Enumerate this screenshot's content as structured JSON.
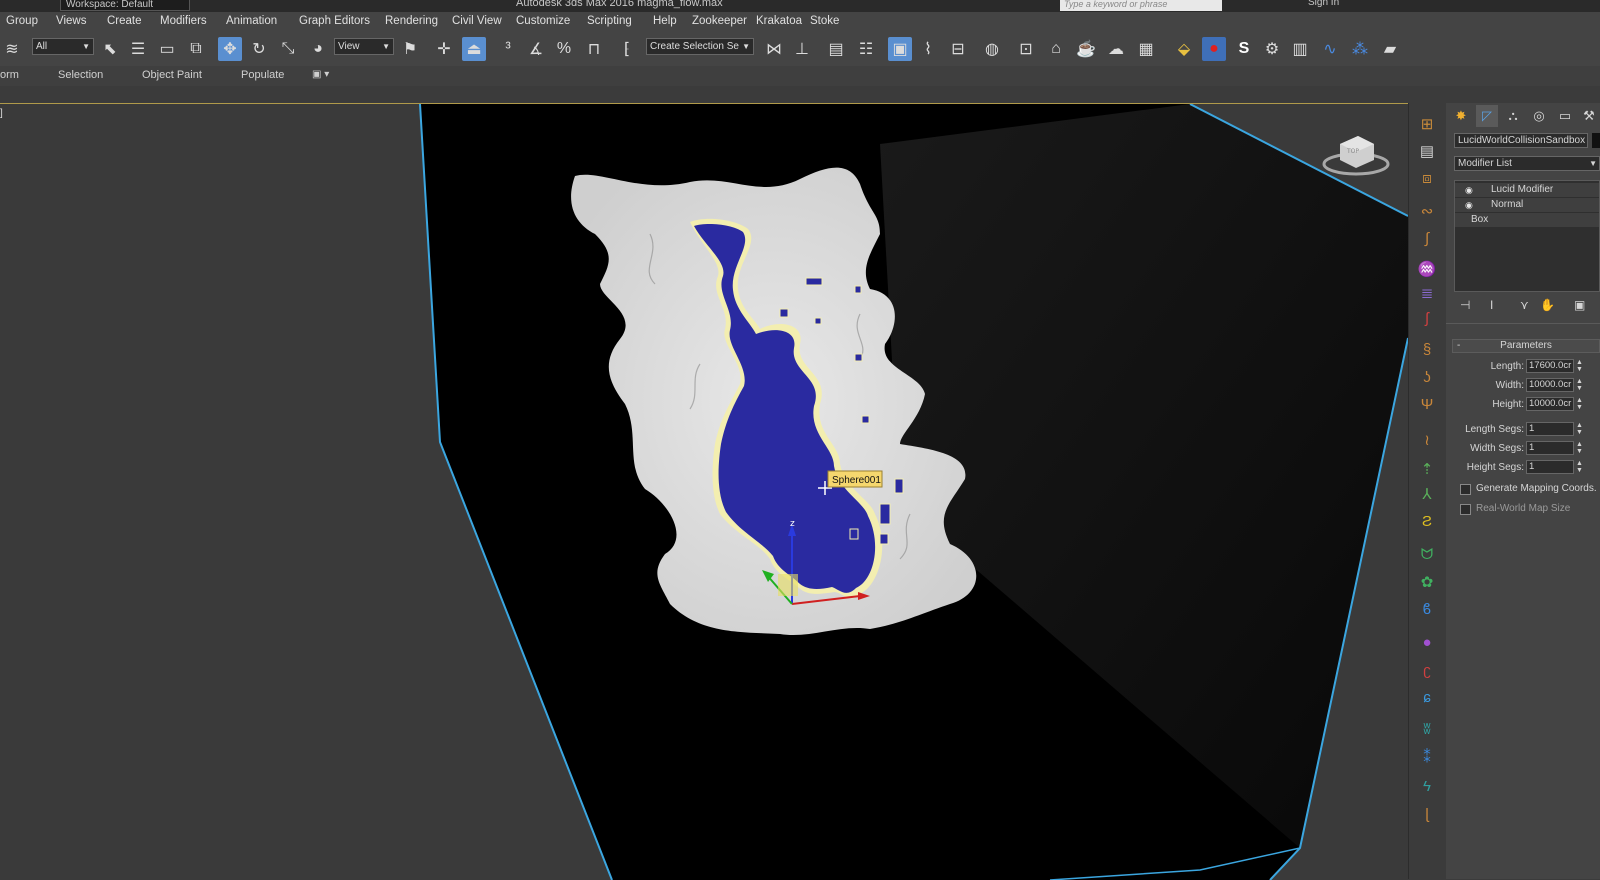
{
  "titlebar": {
    "workspace": "Workspace: Default",
    "title": "Autodesk 3ds Max 2016    magma_flow.max",
    "search_placeholder": "Type a keyword or phrase",
    "sign_in": "Sign In"
  },
  "menu": [
    "Group",
    "Views",
    "Create",
    "Modifiers",
    "Animation",
    "Graph Editors",
    "Rendering",
    "Civil View",
    "Customize",
    "Scripting",
    "Help",
    "Zookeeper",
    "Krakatoa",
    "Stoke"
  ],
  "toolbar": {
    "selection_filter": "All",
    "ref_coord": "View",
    "named_selection": "Create Selection Se"
  },
  "ribbon": {
    "tabs": [
      "orm",
      "Selection",
      "Object Paint",
      "Populate"
    ]
  },
  "viewport": {
    "tooltip": "Sphere001",
    "axis_z": "z",
    "viewcube": "TOP"
  },
  "command_panel": {
    "object_name": "LucidWorldCollisionSandbox",
    "modifier_list": "Modifier List",
    "stack": [
      "Lucid Modifier",
      "Normal",
      "Box"
    ],
    "rollout": "Parameters",
    "params": [
      {
        "label": "Length:",
        "value": "17600.0cr"
      },
      {
        "label": "Width:",
        "value": "10000.0cr"
      },
      {
        "label": "Height:",
        "value": "10000.0cr"
      },
      {
        "label": "Length Segs:",
        "value": "1"
      },
      {
        "label": "Width Segs:",
        "value": "1"
      },
      {
        "label": "Height Segs:",
        "value": "1"
      }
    ],
    "checkboxes": [
      "Generate Mapping Coords.",
      "Real-World Map Size"
    ]
  },
  "colors": {
    "accent": "#5a8fd0",
    "wire": "#3ba6e0",
    "fluid": "#2a2aa0",
    "selection_glow": "#f3eeb0",
    "tooltip_bg": "#f5d76e"
  }
}
